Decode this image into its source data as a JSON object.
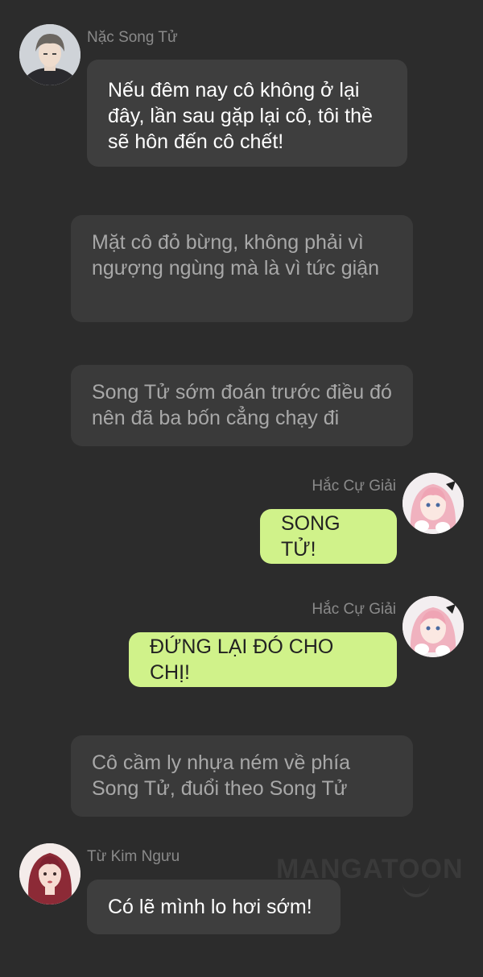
{
  "messages": [
    {
      "type": "character",
      "side": "left",
      "sender": "Nặc Song Tử",
      "text": "Nếu đêm nay cô không ở lại đây, lần sau gặp lại cô, tôi thề sẽ hôn đến cô chết!"
    },
    {
      "type": "narration",
      "text": "Mặt cô đỏ bừng, không phải vì ngượng ngùng mà là vì tức giận"
    },
    {
      "type": "narration",
      "text": "Song Tử sớm đoán trước điều đó nên đã ba bốn cẳng chạy đi"
    },
    {
      "type": "character",
      "side": "right",
      "sender": "Hắc Cự Giải",
      "text": "SONG TỬ!"
    },
    {
      "type": "character",
      "side": "right",
      "sender": "Hắc Cự Giải",
      "text": "ĐỨNG LẠI ĐÓ CHO CHỊ!"
    },
    {
      "type": "narration",
      "text": "Cô cầm ly nhựa ném về phía Song Tử, đuổi theo Song Tử"
    },
    {
      "type": "character",
      "side": "left",
      "sender": "Từ Kim Ngưu",
      "text": "Có lẽ mình lo hơi sớm!"
    }
  ],
  "watermark": "MANGATOON",
  "colors": {
    "background": "#2c2c2c",
    "bubble_dark": "#3e3e3e",
    "bubble_narration": "#3a3a3a",
    "bubble_green": "#d0f28a"
  }
}
